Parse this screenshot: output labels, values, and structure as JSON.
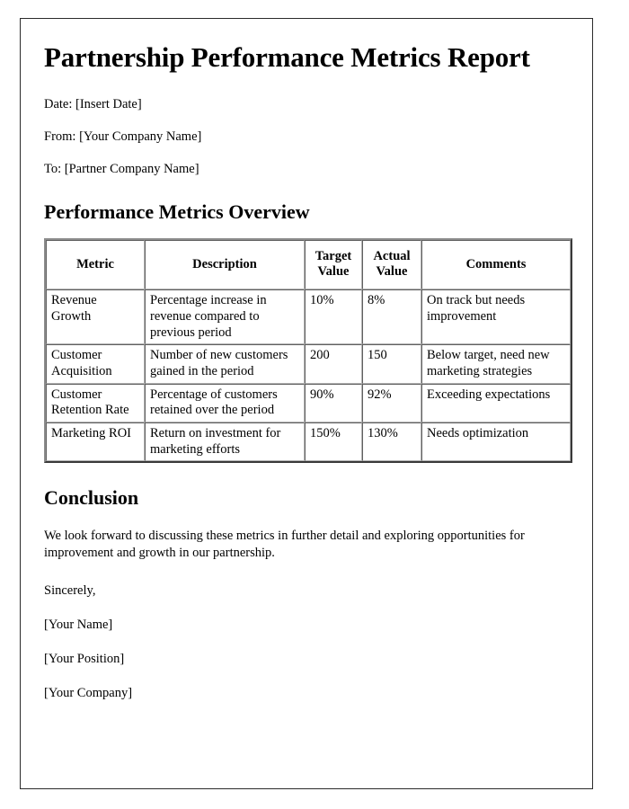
{
  "document": {
    "title": "Partnership Performance Metrics Report",
    "meta": [
      {
        "label": "Date:",
        "value": "[Insert Date]",
        "full": "Date: [Insert Date]"
      },
      {
        "label": "From:",
        "value": "[Your Company Name]",
        "full": "From: [Your Company Name]"
      },
      {
        "label": "To:",
        "value": "[Partner Company Name]",
        "full": "To: [Partner Company Name]"
      }
    ],
    "sections": {
      "overview_heading": "Performance Metrics Overview",
      "conclusion_heading": "Conclusion"
    },
    "table": {
      "headers": [
        "Metric",
        "Description",
        "Target Value",
        "Actual Value",
        "Comments"
      ],
      "rows": [
        {
          "metric": "Revenue Growth",
          "description": "Percentage increase in revenue compared to previous period",
          "target": "10%",
          "actual": "8%",
          "comments": "On track but needs improvement"
        },
        {
          "metric": "Customer Acquisition",
          "description": "Number of new customers gained in the period",
          "target": "200",
          "actual": "150",
          "comments": "Below target, need new marketing strategies"
        },
        {
          "metric": "Customer Retention Rate",
          "description": "Percentage of customers retained over the period",
          "target": "90%",
          "actual": "92%",
          "comments": "Exceeding expectations"
        },
        {
          "metric": "Marketing ROI",
          "description": "Return on investment for marketing efforts",
          "target": "150%",
          "actual": "130%",
          "comments": "Needs optimization"
        }
      ]
    },
    "conclusion": {
      "paragraph": "We look forward to discussing these metrics in further detail and exploring opportunities for improvement and growth in our partnership.",
      "closing": "Sincerely,",
      "signature": [
        "[Your Name]",
        "[Your Position]",
        "[Your Company]"
      ]
    }
  }
}
